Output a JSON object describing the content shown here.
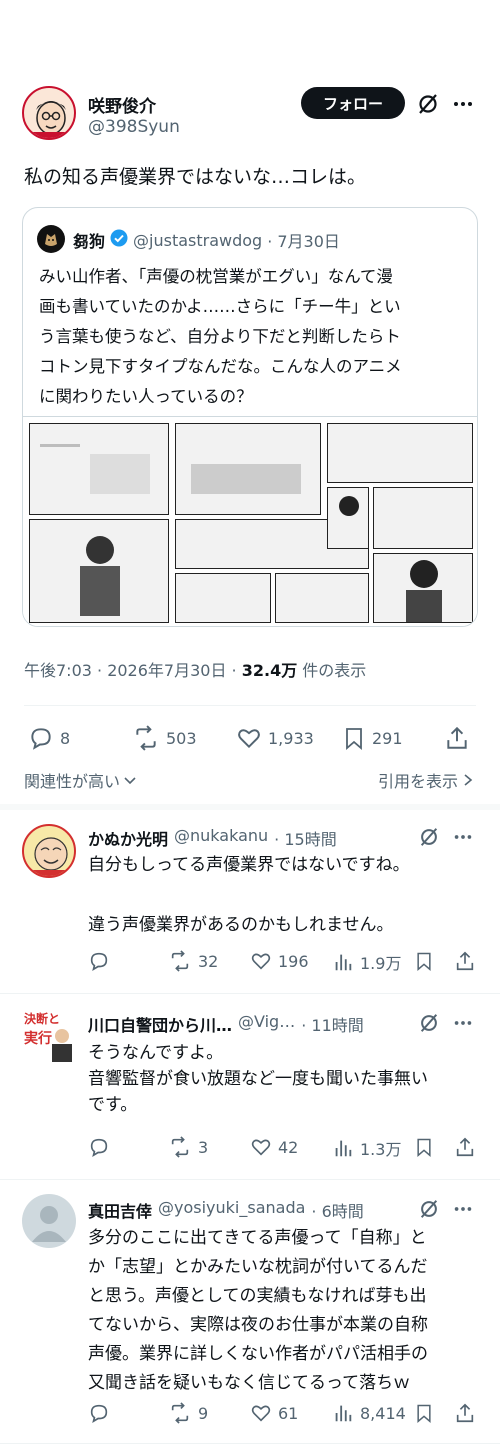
{
  "main_post": {
    "author_name": "咲野俊介",
    "author_handle": "@398Syun",
    "follow_label": "フォロー",
    "text": "私の知る声優業界ではないな…コレは。",
    "quote": {
      "author_name": "芻狗",
      "author_handle": "@justastrawdog",
      "date": "· 7月30日",
      "lines": [
        "みい山作者、「声優の枕営業がエグい」なんて漫",
        "画も書いていたのかよ……さらに「チー牛」とい",
        "う言葉も使うなど、自分より下だと判断したらト",
        "コトン見下すタイプなんだな。こんな人のアニメ",
        "に関わりたい人っているの？"
      ]
    },
    "timestamp": "午後7:03 · 2026年7月30日 ·",
    "views_count": "32.4万",
    "views_label": "件の表示",
    "replies": "8",
    "reposts": "503",
    "likes": "1,933",
    "bookmarks": "291",
    "sort_label": "関連性が高い",
    "quotes_link": "引用を表示"
  },
  "replies": [
    {
      "author_name": "かぬか光明",
      "author_handle": "@nukakanu",
      "time": "· 15時間",
      "lines": [
        "自分もしってる声優業界ではないですね。",
        "",
        "違う声優業界があるのかもしれません。"
      ],
      "replies": "",
      "reposts": "32",
      "likes": "196",
      "views": "1.9万"
    },
    {
      "author_name": "川口自警団から川…",
      "author_handle": "@Vig…",
      "time": "· 11時間",
      "lines": [
        "そうなんですよ。",
        "音響監督が食い放題など一度も聞いた事無い",
        "です。"
      ],
      "replies": "",
      "reposts": "3",
      "likes": "42",
      "views": "1.3万"
    },
    {
      "author_name": "真田吉倖",
      "author_handle": "@yosiyuki_sanada",
      "time": "· 6時間",
      "lines": [
        "多分のここに出てきてる声優って「自称」と",
        "か「志望」とかみたいな枕詞が付いてるんだ",
        "と思う。声優としての実績もなければ芽も出",
        "てないから、実際は夜のお仕事が本業の自称",
        "声優。業界に詳しくない作者がパパ活相手の",
        "又聞き話を疑いもなく信じてるって落ちｗ"
      ],
      "replies": "",
      "reposts": "9",
      "likes": "61",
      "views": "8,414"
    }
  ],
  "avatar_texts": {
    "reply2_banner_top": "決断と",
    "reply2_banner_bottom": "実行"
  },
  "colors": {
    "accent": "#1d9bf0",
    "text": "#0f1419",
    "gray": "#536471",
    "follow_bg": "#0f1419"
  }
}
